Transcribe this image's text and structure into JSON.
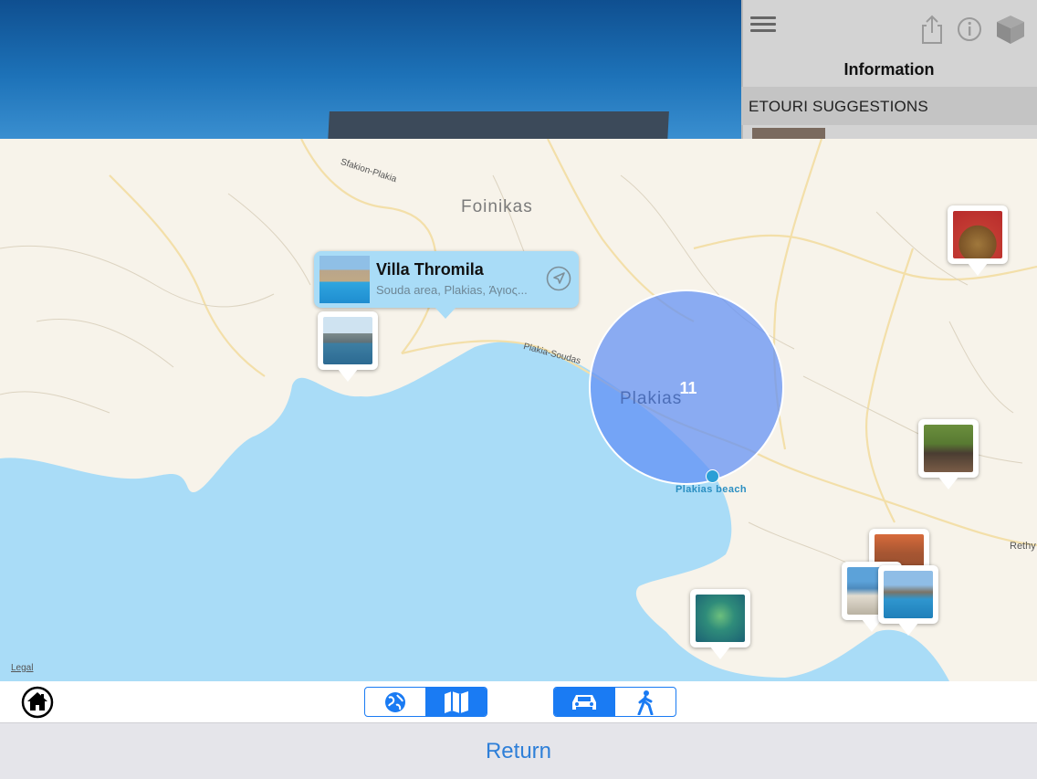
{
  "side_panel": {
    "title": "Information",
    "suggestions_label": "ETOURI SUGGESTIONS"
  },
  "map": {
    "labels": {
      "foinikas": "Foinikas",
      "sfakion": "Sfakion-Plakia",
      "road": "Plakia-Soudas",
      "plakias": "Plakias",
      "beach": "Plakias beach",
      "rethy": "Rethy",
      "legal": "Legal"
    },
    "cluster_count": "11",
    "callout": {
      "title": "Villa Thromila",
      "subtitle": "Souda area, Plakias, Άγιος..."
    }
  },
  "toolbar": {
    "map_mode": {
      "options": [
        "globe-icon",
        "map-icon"
      ],
      "selected": "map-icon"
    },
    "travel_mode": {
      "options": [
        "car-icon",
        "walk-icon"
      ],
      "selected": "car-icon"
    }
  },
  "return_label": "Return",
  "colors": {
    "accent": "#1a7bf3",
    "sea": "#a9dcf7",
    "land": "#f7f3ea",
    "cluster": "#608ff5",
    "callout": "#a9dcf7"
  }
}
